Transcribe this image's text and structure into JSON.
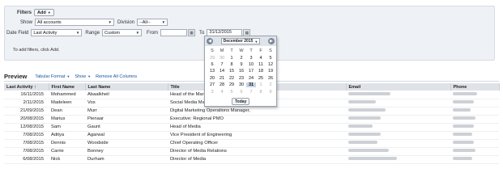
{
  "filters": {
    "label": "Filters",
    "add_label": "Add",
    "show_label": "Show",
    "show_value": "All accounts",
    "division_label": "Division",
    "division_value": "--All--",
    "date_field_label": "Date Field",
    "date_field_value": "Last Activity",
    "range_label": "Range",
    "range_value": "Custom",
    "from_label": "From",
    "from_value": "",
    "to_label": "To",
    "to_value": "31/12/2015",
    "note_prefix": "To add filters, click ",
    "note_link": "Add",
    "note_suffix": "."
  },
  "datepicker": {
    "prev_icon": "chevron-left-icon",
    "next_icon": "chevron-right-icon",
    "month_label": "December 2015",
    "weekdays": [
      "S",
      "M",
      "T",
      "W",
      "T",
      "F",
      "S"
    ],
    "weeks": [
      [
        "29",
        "30",
        "1",
        "2",
        "3",
        "4",
        "5"
      ],
      [
        "6",
        "7",
        "8",
        "9",
        "10",
        "11",
        "12"
      ],
      [
        "13",
        "14",
        "15",
        "16",
        "17",
        "18",
        "19"
      ],
      [
        "20",
        "21",
        "22",
        "23",
        "24",
        "25",
        "26"
      ],
      [
        "27",
        "28",
        "29",
        "30",
        "31",
        "1",
        "2"
      ],
      [
        "3",
        "4",
        "5",
        "6",
        "7",
        "8",
        "9"
      ]
    ],
    "selected_day": "31",
    "today_label": "Today"
  },
  "preview": {
    "title": "Preview",
    "format_label": "Tabular Format",
    "show_label": "Show",
    "remove_label": "Remove All Columns",
    "columns": [
      "Last Activity ↑",
      "First Name",
      "Last Name",
      "Title",
      "Email",
      "Phone"
    ],
    "rows": [
      [
        "16/11/2015",
        "Mohammed",
        "Abaalkheil",
        "Head of the Marketing Communications Division",
        "",
        ""
      ],
      [
        "2/11/2015",
        "Madeleen",
        "Vos",
        "Social Media Manager",
        "",
        ""
      ],
      [
        "21/09/2015",
        "Dean",
        "Murr",
        "Digital Marketing Operations Manager,",
        "",
        ""
      ],
      [
        "20/08/2015",
        "Marius",
        "Pienaar",
        "Executive: Regional PMO",
        "",
        ""
      ],
      [
        "12/08/2015",
        "Sam",
        "Gaunt",
        "Head of Media",
        "",
        ""
      ],
      [
        "7/08/2015",
        "Aditya",
        "Agarwal",
        "Vice President of Engineering",
        "",
        ""
      ],
      [
        "7/08/2015",
        "Dennis",
        "Woodside",
        "Chief Operating Officer",
        "",
        ""
      ],
      [
        "7/08/2015",
        "Carrie",
        "Bonney",
        "Director of Media Relations",
        "",
        ""
      ],
      [
        "6/08/2015",
        "Nick",
        "Durham",
        "Director of Media",
        "",
        ""
      ]
    ]
  },
  "colors": {
    "panel_bg": "#eef1f5",
    "link": "#15519c",
    "header_bg": "#dfe3e8"
  }
}
